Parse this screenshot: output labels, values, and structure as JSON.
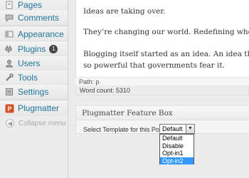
{
  "sidebar": {
    "items": [
      {
        "label": "Pages",
        "icon": "pages-icon"
      },
      {
        "label": "Comments",
        "icon": "comments-icon"
      },
      {
        "label": "Appearance",
        "icon": "appearance-icon"
      },
      {
        "label": "Plugins",
        "icon": "plugins-icon",
        "badge": "1"
      },
      {
        "label": "Users",
        "icon": "users-icon"
      },
      {
        "label": "Tools",
        "icon": "tools-icon"
      },
      {
        "label": "Settings",
        "icon": "settings-icon"
      },
      {
        "label": "Plugmatter",
        "icon": "plugmatter-icon"
      }
    ],
    "collapse_label": "Collapse menu"
  },
  "editor": {
    "lines": [
      "Ideas are taking over.",
      "They’re changing our world. Redefining who we are. Cr",
      "Blogging itself started as an idea. An idea that evolved",
      "so powerful that governments fear it."
    ],
    "path": "Path: p",
    "word_count": "Word count: 5310"
  },
  "feature_box": {
    "title": "Plugmatter Feature Box",
    "select_label": "Select Template for this Post:",
    "selected": "Default",
    "options": [
      "Default",
      "Disable",
      "Opt-in1",
      "Opt-in2"
    ],
    "highlighted_option": "Opt-in2"
  },
  "colors": {
    "link": "#21759b",
    "highlight": "#3399ff",
    "plugmatter_brand": "#d54e21"
  }
}
